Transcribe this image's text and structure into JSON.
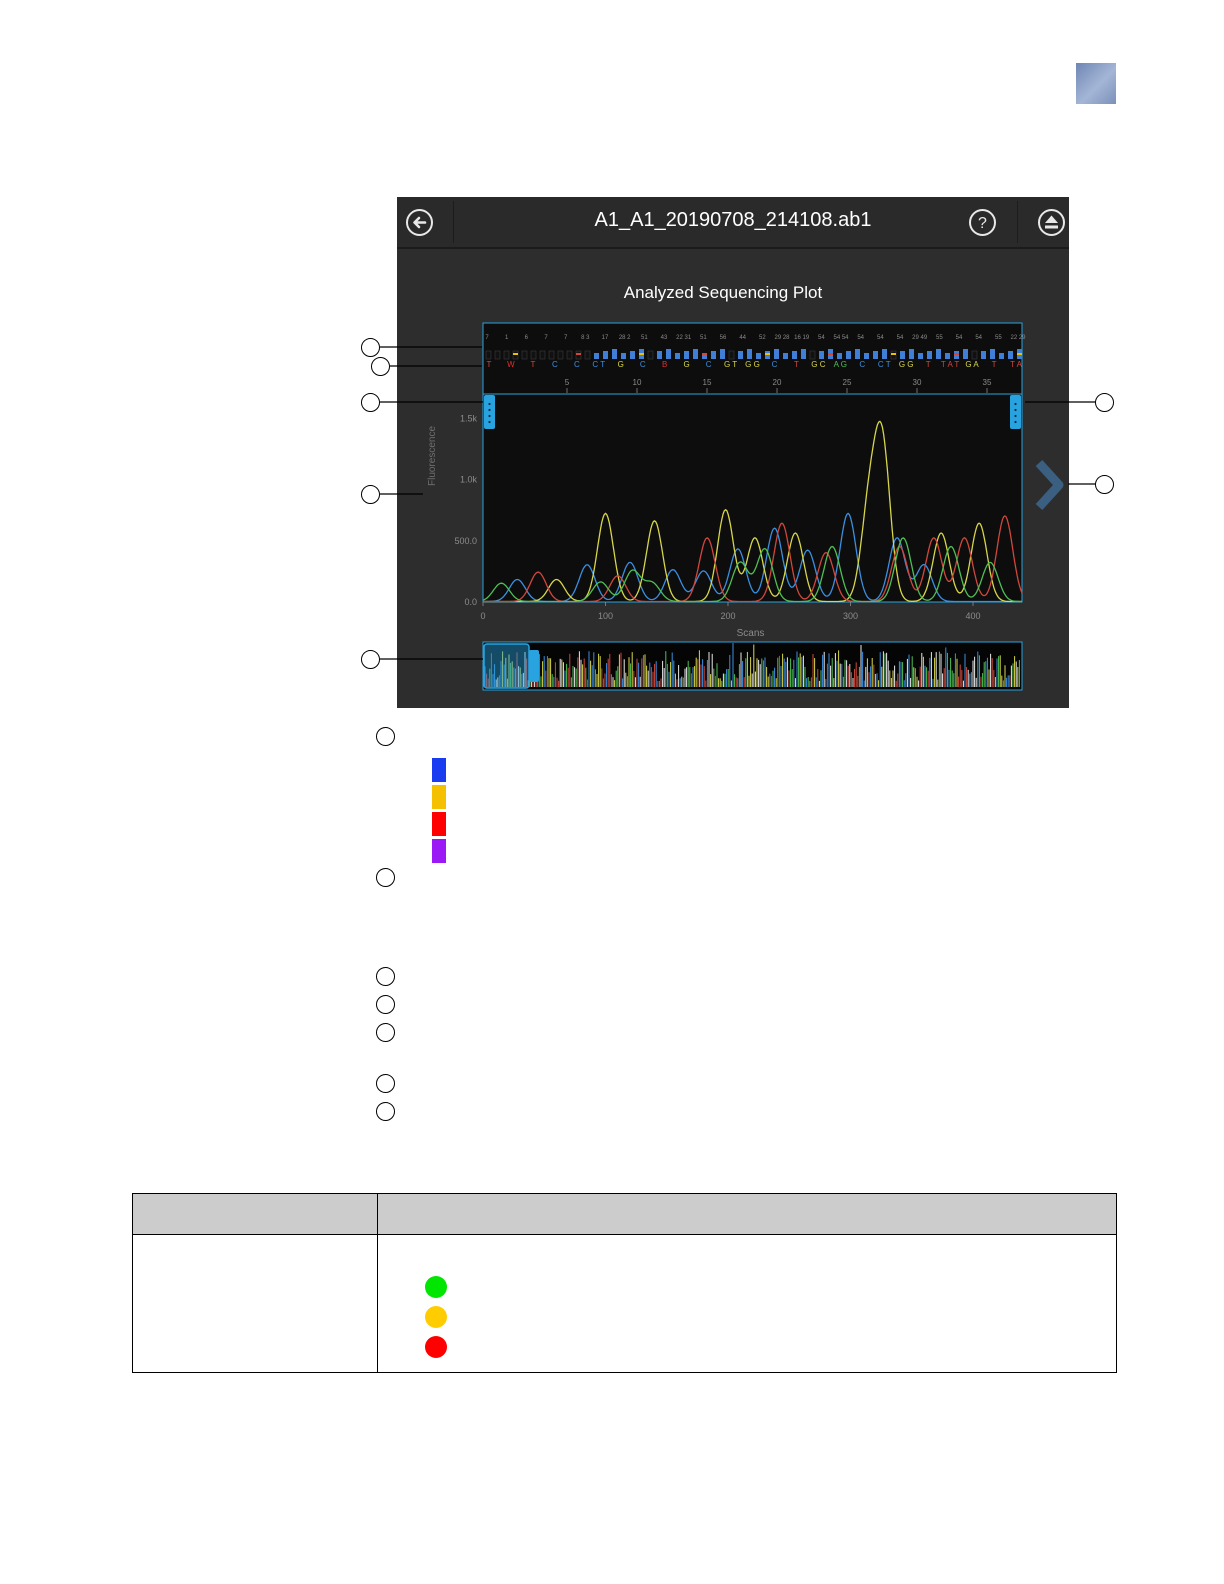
{
  "app": {
    "file_title": "A1_A1_20190708_214108.ab1",
    "plot_title": "Analyzed Sequencing Plot",
    "icons": {
      "back": "back-arrow-icon",
      "help": "help-icon",
      "eject": "eject-icon",
      "next": "chevron-right-icon"
    },
    "y_axis_label": "Fluorescence",
    "x_axis_label": "Scans",
    "y_ticks": [
      "1.5k",
      "1.0k",
      "500.0",
      "0.0"
    ],
    "x_ticks": [
      "0",
      "100",
      "200",
      "300",
      "400"
    ],
    "base_position_ticks": [
      "5",
      "10",
      "15",
      "20",
      "25",
      "30",
      "35"
    ],
    "qv_labels": [
      "7",
      "1",
      "6",
      "7",
      "7",
      "8 3",
      "17",
      "28 2",
      "51",
      "43",
      "22 31",
      "51",
      "56",
      "44",
      "52",
      "29 28",
      "16 19",
      "54",
      "54 54",
      "54",
      "54",
      "54",
      "29 49",
      "55",
      "54",
      "54",
      "55",
      "22 29"
    ],
    "base_calls": [
      "T",
      "W",
      "T",
      "C",
      "C",
      "C T",
      "G",
      "C",
      "B",
      "G",
      "C",
      "G T",
      "G G",
      "C",
      "T",
      "G C",
      "A G",
      "C",
      "C T",
      "G G",
      "T",
      "T A T",
      "G A",
      "T",
      "T A"
    ]
  },
  "colors": {
    "background_dark": "#2d2d2d",
    "plot_area": "#0d0d0d",
    "accent": "#29a3e0",
    "trace_blue": "#3b8fe0",
    "trace_yellow": "#d7d64a",
    "trace_red": "#d0473c",
    "trace_green": "#4fbf55"
  },
  "legend_swatches": [
    "#1a3cf0",
    "#f5c000",
    "#ff0000",
    "#9b19f5"
  ],
  "legend_dots": [
    "#00e600",
    "#ffcc00",
    "#ff0000"
  ],
  "chart_data": {
    "type": "line",
    "xlabel": "Scans",
    "ylabel": "Fluorescence",
    "xlim": [
      0,
      440
    ],
    "ylim": [
      0,
      1700
    ],
    "series": [
      {
        "color": "blue",
        "peaks": [
          [
            28,
            180
          ],
          [
            85,
            300
          ],
          [
            120,
            320
          ],
          [
            155,
            260
          ],
          [
            180,
            250
          ],
          [
            208,
            430
          ],
          [
            238,
            600
          ],
          [
            265,
            420
          ],
          [
            298,
            720
          ],
          [
            338,
            520
          ],
          [
            360,
            300
          ]
        ]
      },
      {
        "color": "yellow",
        "peaks": [
          [
            60,
            180
          ],
          [
            100,
            720
          ],
          [
            140,
            660
          ],
          [
            198,
            750
          ],
          [
            222,
            520
          ],
          [
            255,
            560
          ],
          [
            315,
            730
          ],
          [
            326,
            1250
          ],
          [
            374,
            560
          ],
          [
            405,
            640
          ]
        ]
      },
      {
        "color": "red",
        "peaks": [
          [
            45,
            240
          ],
          [
            110,
            210
          ],
          [
            183,
            520
          ],
          [
            244,
            640
          ],
          [
            280,
            400
          ],
          [
            340,
            450
          ],
          [
            368,
            520
          ],
          [
            393,
            520
          ],
          [
            426,
            700
          ]
        ]
      },
      {
        "color": "green",
        "peaks": [
          [
            15,
            150
          ],
          [
            96,
            160
          ],
          [
            122,
            250
          ],
          [
            138,
            150
          ],
          [
            210,
            320
          ],
          [
            230,
            430
          ],
          [
            285,
            450
          ],
          [
            343,
            520
          ],
          [
            382,
            450
          ],
          [
            414,
            320
          ]
        ]
      }
    ]
  }
}
